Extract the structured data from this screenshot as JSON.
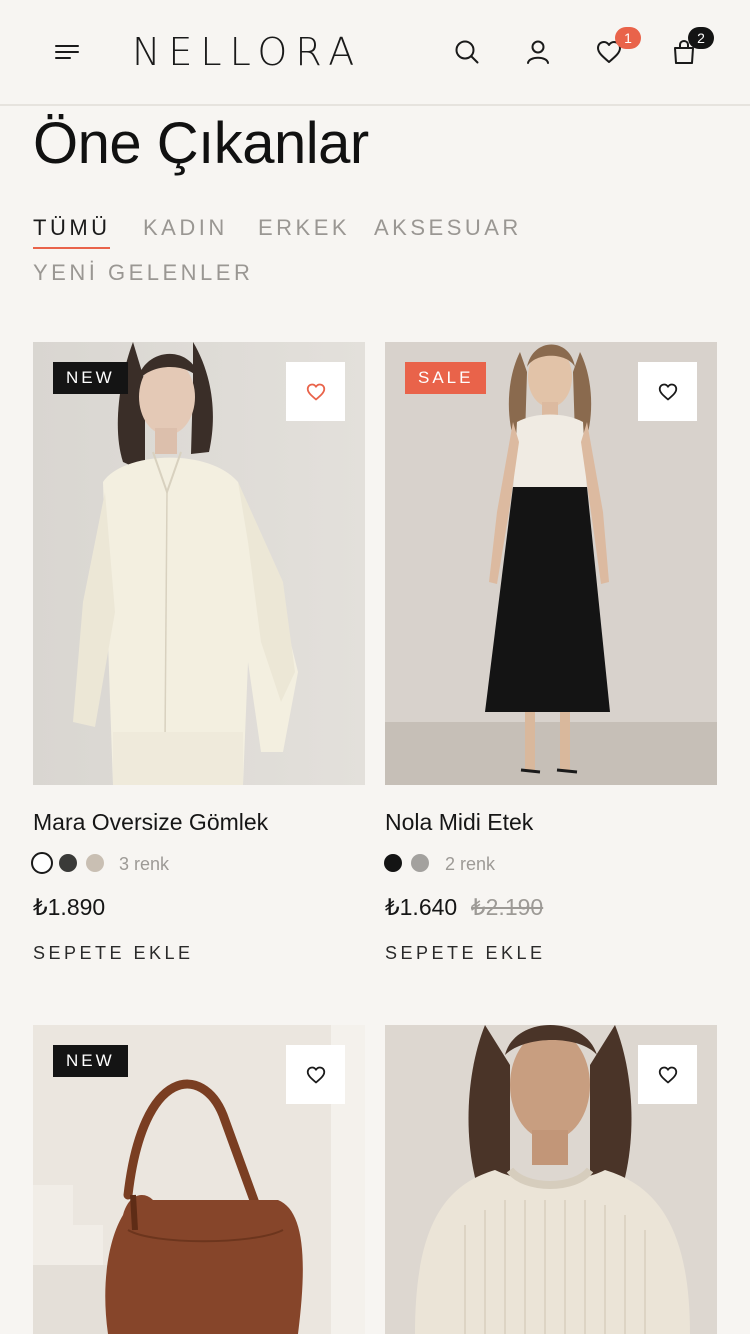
{
  "header": {
    "logo": "NELLORA",
    "wishlist_count": "1",
    "cart_count": "2"
  },
  "page": {
    "title": "Öne Çıkanlar"
  },
  "tabs": [
    {
      "label": "TÜMÜ",
      "active": true
    },
    {
      "label": "KADIN",
      "active": false
    },
    {
      "label": "ERKEK",
      "active": false
    },
    {
      "label": "AKSESUAR",
      "active": false
    },
    {
      "label": "YENİ GELENLER",
      "active": false
    }
  ],
  "products": [
    {
      "tag": "NEW",
      "name": "Mara Oversize Gömlek",
      "colors_label": "3 renk",
      "swatches": [
        "#ffffff",
        "#3a3a38",
        "#c9bfb3"
      ],
      "price": "₺1.890",
      "add_label": "SEPETE EKLE"
    },
    {
      "tag": "SALE",
      "name": "Nola Midi Etek",
      "colors_label": "2 renk",
      "swatches": [
        "#141414",
        "#a3a19e"
      ],
      "price": "₺1.640",
      "old_price": "₺2.190",
      "add_label": "SEPETE EKLE"
    },
    {
      "tag": "NEW"
    },
    {
      "tag": ""
    }
  ],
  "colors": {
    "accent": "#e9634a",
    "background": "#f7f5f2",
    "tag_new": "#141414",
    "tag_sale": "#e9634a",
    "text": "#141414",
    "muted": "#9a9793"
  }
}
